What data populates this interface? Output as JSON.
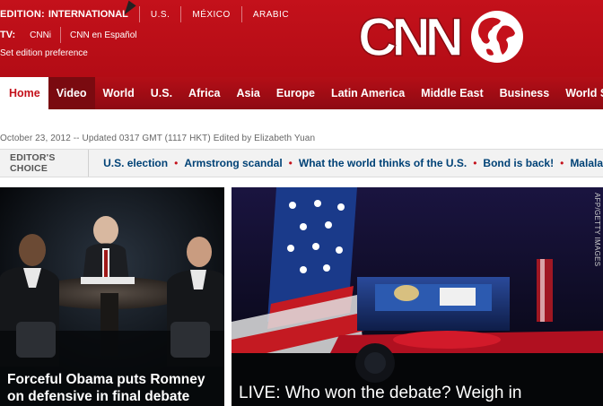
{
  "header": {
    "edition_label": "EDITION:",
    "edition_current": "INTERNATIONAL",
    "editions": [
      "U.S.",
      "MÉXICO",
      "ARABIC"
    ],
    "tv_label": "TV:",
    "tv_links": [
      "CNNi",
      "CNN en Español"
    ],
    "edition_pref": "Set edition preference",
    "logo_text": "CNN",
    "brand_color": "#c4111b"
  },
  "nav": {
    "items": [
      "Home",
      "Video",
      "World",
      "U.S.",
      "Africa",
      "Asia",
      "Europe",
      "Latin America",
      "Middle East",
      "Business",
      "World Sport"
    ]
  },
  "meta": {
    "timestamp": "October 23, 2012 -- Updated 0317 GMT (1117 HKT) Edited by Elizabeth Yuan"
  },
  "editors_choice": {
    "label": "EDITOR'S CHOICE",
    "links": [
      "U.S. election",
      "Armstrong scandal",
      "What the world thinks of the U.S.",
      "Bond is back!",
      "Malala"
    ]
  },
  "stories": {
    "left": {
      "caption": "Forceful Obama puts Romney on defensive in final debate"
    },
    "right": {
      "caption": "LIVE: Who won the debate? Weigh in",
      "credit": "AFP/GETTY IMAGES"
    }
  }
}
